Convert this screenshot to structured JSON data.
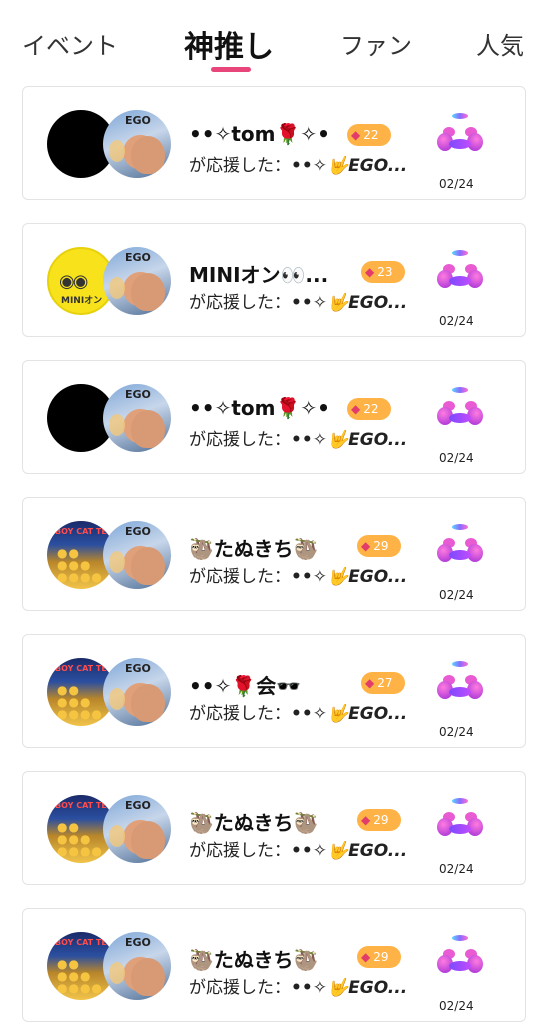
{
  "tabs": [
    {
      "label": "イベント",
      "active": false
    },
    {
      "label": "神推し",
      "active": true
    },
    {
      "label": "ファン",
      "active": false
    },
    {
      "label": "人気",
      "active": false
    }
  ],
  "accent": "#e8457a",
  "items": [
    {
      "name": "••✧tom🌹✧•",
      "level": "22",
      "supported_prefix": "が応援した：",
      "supported_name": "••✧🤟EGO...",
      "date": "02/24",
      "avatar": "black",
      "gift_icon": "dumbbell-icon"
    },
    {
      "name": "MINIオン👀...",
      "level": "23",
      "supported_prefix": "が応援した：",
      "supported_name": "••✧🤟EGO...",
      "date": "02/24",
      "avatar": "minion",
      "gift_icon": "dumbbell-icon"
    },
    {
      "name": "••✧tom🌹✧•",
      "level": "22",
      "supported_prefix": "が応援した：",
      "supported_name": "••✧🤟EGO...",
      "date": "02/24",
      "avatar": "black",
      "gift_icon": "dumbbell-icon"
    },
    {
      "name": "🦥たぬきち🦥",
      "level": "29",
      "supported_prefix": "が応援した：",
      "supported_name": "••✧🤟EGO...",
      "date": "02/24",
      "avatar": "gold",
      "gift_icon": "dumbbell-icon"
    },
    {
      "name": "••✧🌹会🕶️",
      "level": "27",
      "supported_prefix": "が応援した：",
      "supported_name": "••✧🤟EGO...",
      "date": "02/24",
      "avatar": "gold",
      "gift_icon": "dumbbell-icon"
    },
    {
      "name": "🦥たぬきち🦥",
      "level": "29",
      "supported_prefix": "が応援した：",
      "supported_name": "••✧🤟EGO...",
      "date": "02/24",
      "avatar": "gold",
      "gift_icon": "dumbbell-icon"
    },
    {
      "name": "🦥たぬきち🦥",
      "level": "29",
      "supported_prefix": "が応援した：",
      "supported_name": "••✧🤟EGO...",
      "date": "02/24",
      "avatar": "gold",
      "gift_icon": "dumbbell-icon"
    }
  ],
  "avatar_texts": {
    "right_hat": "EGO",
    "minion_label": "MINIオン",
    "gold_banner": "BOY CAT TEA"
  }
}
